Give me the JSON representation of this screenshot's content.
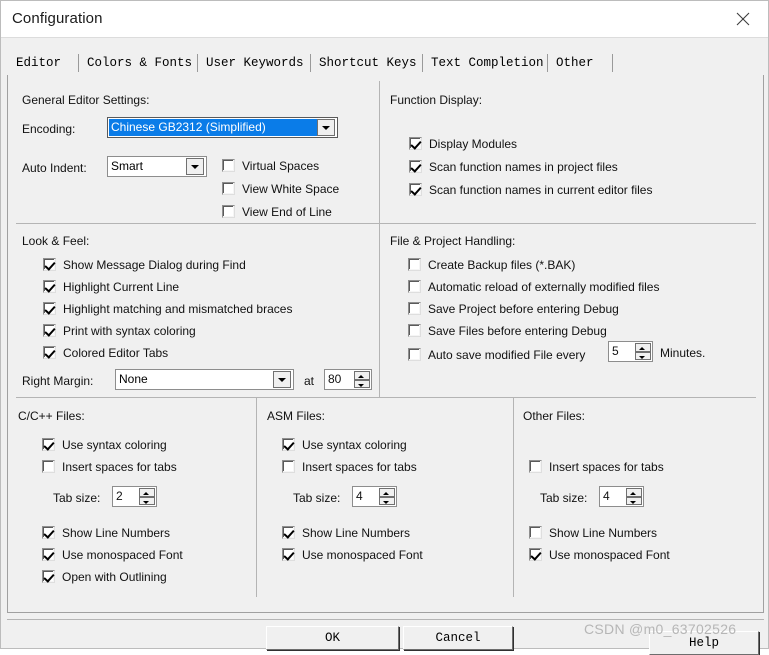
{
  "window": {
    "title": "Configuration",
    "close_icon": "close-icon"
  },
  "tabs": [
    {
      "label": "Editor",
      "active": true
    },
    {
      "label": "Colors & Fonts",
      "active": false
    },
    {
      "label": "User Keywords",
      "active": false
    },
    {
      "label": "Shortcut Keys",
      "active": false
    },
    {
      "label": "Text Completion",
      "active": false
    },
    {
      "label": "Other",
      "active": false
    }
  ],
  "general_editor_settings": {
    "title": "General Editor Settings:",
    "encoding_label": "Encoding:",
    "encoding_value": "Chinese GB2312 (Simplified)",
    "auto_indent_label": "Auto Indent:",
    "auto_indent_value": "Smart",
    "checkboxes": [
      {
        "label": "Virtual Spaces",
        "checked": false
      },
      {
        "label": "View White Space",
        "checked": false
      },
      {
        "label": "View End of Line",
        "checked": false
      }
    ]
  },
  "function_display": {
    "title": "Function Display:",
    "checkboxes": [
      {
        "label": "Display Modules",
        "checked": true
      },
      {
        "label": "Scan function names in project files",
        "checked": true
      },
      {
        "label": "Scan function names in current editor files",
        "checked": true
      }
    ]
  },
  "look_and_feel": {
    "title": "Look & Feel:",
    "checkboxes": [
      {
        "label": "Show Message Dialog during Find",
        "checked": true
      },
      {
        "label": "Highlight Current Line",
        "checked": true
      },
      {
        "label": "Highlight matching and mismatched braces",
        "checked": true
      },
      {
        "label": "Print with syntax coloring",
        "checked": true
      },
      {
        "label": "Colored Editor Tabs",
        "checked": true
      }
    ],
    "right_margin_label": "Right Margin:",
    "right_margin_value": "None",
    "at_label": "at",
    "at_value": "80"
  },
  "file_project_handling": {
    "title": "File & Project Handling:",
    "checkboxes": [
      {
        "label": "Create Backup files (*.BAK)",
        "checked": false
      },
      {
        "label": "Automatic reload of externally modified files",
        "checked": false
      },
      {
        "label": "Save Project before entering Debug",
        "checked": false
      },
      {
        "label": "Save Files before entering Debug",
        "checked": false
      },
      {
        "label": "Auto save modified File every",
        "checked": false
      }
    ],
    "auto_save_value": "5",
    "minutes_label": "Minutes."
  },
  "c_cpp_files": {
    "title": "C/C++ Files:",
    "syntax_coloring": {
      "label": "Use syntax coloring",
      "checked": true
    },
    "insert_spaces": {
      "label": "Insert spaces for tabs",
      "checked": false
    },
    "tab_size_label": "Tab size:",
    "tab_size_value": "2",
    "line_numbers": {
      "label": "Show Line Numbers",
      "checked": true
    },
    "monospaced": {
      "label": "Use monospaced Font",
      "checked": true
    },
    "outlining": {
      "label": "Open with Outlining",
      "checked": true
    }
  },
  "asm_files": {
    "title": "ASM Files:",
    "syntax_coloring": {
      "label": "Use syntax coloring",
      "checked": true
    },
    "insert_spaces": {
      "label": "Insert spaces for tabs",
      "checked": false
    },
    "tab_size_label": "Tab size:",
    "tab_size_value": "4",
    "line_numbers": {
      "label": "Show Line Numbers",
      "checked": true
    },
    "monospaced": {
      "label": "Use monospaced Font",
      "checked": true
    }
  },
  "other_files": {
    "title": "Other Files:",
    "insert_spaces": {
      "label": "Insert spaces for tabs",
      "checked": false
    },
    "tab_size_label": "Tab size:",
    "tab_size_value": "4",
    "line_numbers": {
      "label": "Show Line Numbers",
      "checked": false
    },
    "monospaced": {
      "label": "Use monospaced Font",
      "checked": true
    }
  },
  "footer": {
    "ok_label": "OK",
    "cancel_label": "Cancel",
    "help_label": "Help"
  },
  "watermark": "CSDN @m0_63702526",
  "colors": {
    "dialog_bg": "#f0f0f0",
    "titlebar_bg": "#ffffff",
    "selection_blue": "#0a7ce8",
    "divider": "#b4b4b4"
  }
}
